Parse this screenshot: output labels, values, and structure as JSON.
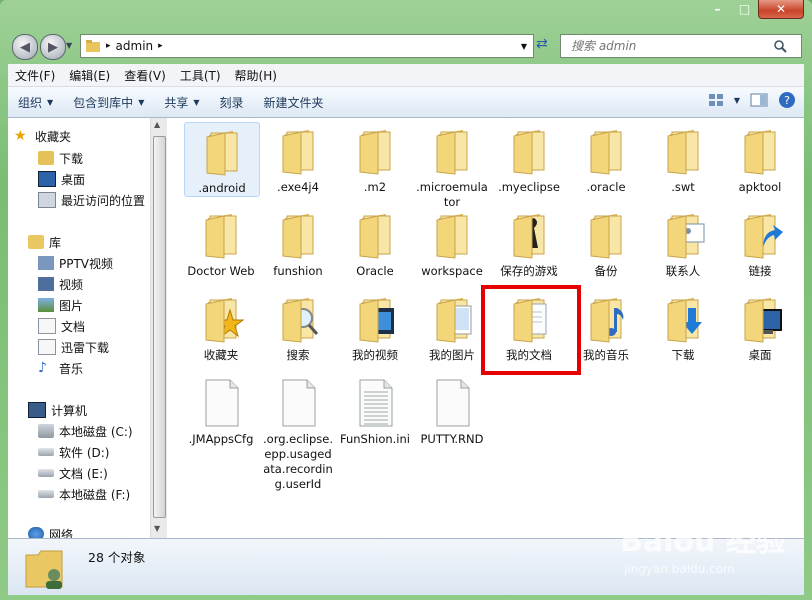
{
  "window": {
    "buttons": {
      "minimize": "–",
      "maximize": "□",
      "close": "✕"
    }
  },
  "address": {
    "path": "admin",
    "separator": "▸"
  },
  "search": {
    "placeholder": "搜索 admin"
  },
  "menu": [
    "文件(F)",
    "编辑(E)",
    "查看(V)",
    "工具(T)",
    "帮助(H)"
  ],
  "toolbar": {
    "organize": "组织",
    "include": "包含到库中",
    "share": "共享",
    "burn": "刻录",
    "new_folder": "新建文件夹",
    "dropdown_arrow": "▼"
  },
  "nav": {
    "favorites": {
      "label": "收藏夹",
      "items": [
        "下载",
        "桌面",
        "最近访问的位置"
      ]
    },
    "libraries": {
      "label": "库",
      "items": [
        "PPTV视频",
        "视频",
        "图片",
        "文档",
        "迅雷下载",
        "音乐"
      ]
    },
    "computer": {
      "label": "计算机",
      "items": [
        "本地磁盘 (C:)",
        "软件 (D:)",
        "文档 (E:)",
        "本地磁盘 (F:)"
      ]
    },
    "network": {
      "label": "网络"
    }
  },
  "files": [
    {
      "name": ".android",
      "kind": "folder",
      "selected": true
    },
    {
      "name": ".exe4j4",
      "kind": "folder"
    },
    {
      "name": ".m2",
      "kind": "folder"
    },
    {
      "name": ".microemulator",
      "kind": "folder"
    },
    {
      "name": ".myeclipse",
      "kind": "folder"
    },
    {
      "name": ".oracle",
      "kind": "folder"
    },
    {
      "name": ".swt",
      "kind": "folder"
    },
    {
      "name": "apktool",
      "kind": "folder"
    },
    {
      "name": "Doctor Web",
      "kind": "folder"
    },
    {
      "name": "funshion",
      "kind": "folder"
    },
    {
      "name": "Oracle",
      "kind": "folder"
    },
    {
      "name": "workspace",
      "kind": "folder"
    },
    {
      "name": "保存的游戏",
      "kind": "folder",
      "overlay": "chess-piece-icon"
    },
    {
      "name": "备份",
      "kind": "folder"
    },
    {
      "name": "联系人",
      "kind": "folder",
      "overlay": "contact-card-icon"
    },
    {
      "name": "链接",
      "kind": "folder",
      "overlay": "arrow-icon"
    },
    {
      "name": "收藏夹",
      "kind": "folder",
      "overlay": "star-icon"
    },
    {
      "name": "搜索",
      "kind": "folder",
      "overlay": "magnifier-icon"
    },
    {
      "name": "我的视频",
      "kind": "folder",
      "overlay": "film-icon"
    },
    {
      "name": "我的图片",
      "kind": "folder",
      "overlay": "picture-icon"
    },
    {
      "name": "我的文档",
      "kind": "folder",
      "overlay": "document-icon",
      "highlighted": true
    },
    {
      "name": "我的音乐",
      "kind": "folder",
      "overlay": "music-note-icon"
    },
    {
      "name": "下载",
      "kind": "folder",
      "overlay": "download-arrow-icon"
    },
    {
      "name": "桌面",
      "kind": "folder",
      "overlay": "monitor-icon"
    },
    {
      "name": ".JMAppsCfg",
      "kind": "file"
    },
    {
      "name": ".org.eclipse.epp.usagedata.recording.userId",
      "kind": "file"
    },
    {
      "name": "FunShion.ini",
      "kind": "textfile"
    },
    {
      "name": "PUTTY.RND",
      "kind": "file"
    }
  ],
  "status": {
    "count_text": "28 个对象"
  },
  "watermark": {
    "logo": "Baiðu 经验",
    "url": "jingyan.baidu.com"
  },
  "colors": {
    "folder": "#f3d57a",
    "folder_dark": "#d9b24e",
    "highlight": "#e60000",
    "command_text": "#1e395b"
  }
}
